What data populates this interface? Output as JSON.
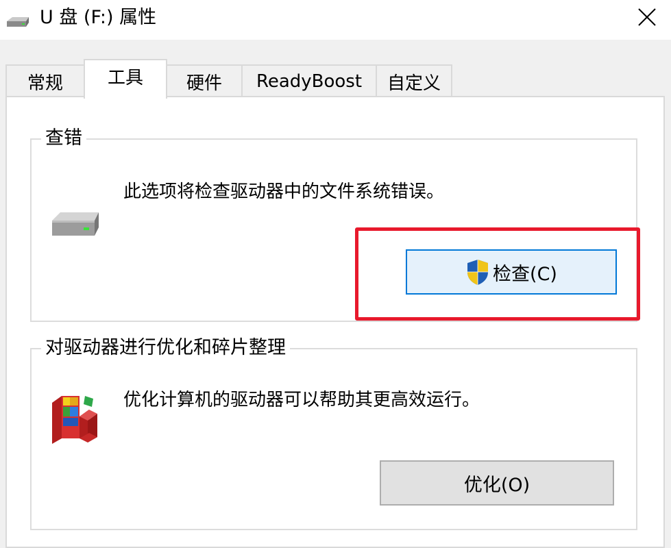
{
  "window": {
    "title": "U 盘 (F:) 属性"
  },
  "tabs": [
    {
      "label": "常规",
      "active": false
    },
    {
      "label": "工具",
      "active": true
    },
    {
      "label": "硬件",
      "active": false
    },
    {
      "label": "ReadyBoost",
      "active": false
    },
    {
      "label": "自定义",
      "active": false
    }
  ],
  "error_check": {
    "title": "查错",
    "description": "此选项将检查驱动器中的文件系统错误。",
    "button_label": "检查(C)",
    "icon": "drive-icon"
  },
  "optimize": {
    "title": "对驱动器进行优化和碎片整理",
    "description": "优化计算机的驱动器可以帮助其更高效运行。",
    "button_label": "优化(O)",
    "icon": "defrag-icon"
  },
  "colors": {
    "highlight": "#e8192c",
    "accent": "#0078d7"
  }
}
